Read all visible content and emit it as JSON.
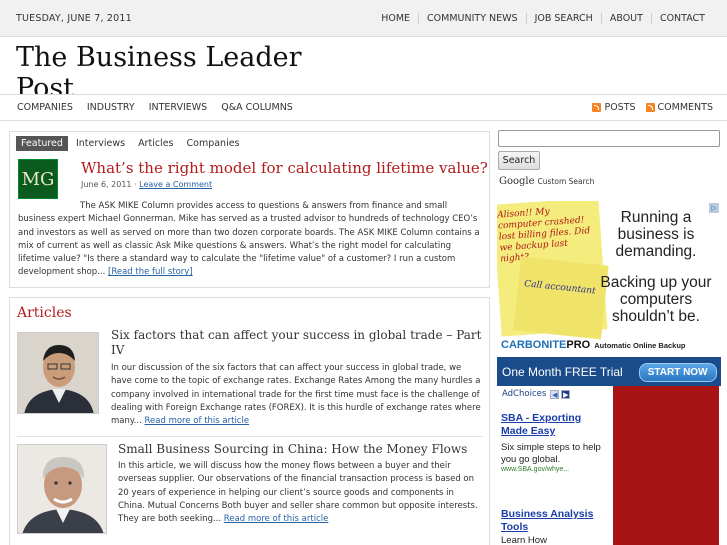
{
  "topbar": {
    "date": "TUESDAY, JUNE 7, 2011",
    "nav": [
      "HOME",
      "COMMUNITY NEWS",
      "JOB SEARCH",
      "ABOUT",
      "CONTACT"
    ]
  },
  "site": {
    "title": "The Business Leader Post"
  },
  "catnav": {
    "items": [
      "COMPANIES",
      "INDUSTRY",
      "INTERVIEWS",
      "Q&A COLUMNS"
    ],
    "posts": "POSTS",
    "comments": "COMMENTS"
  },
  "featured": {
    "tabs": [
      "Featured",
      "Interviews",
      "Articles",
      "Companies"
    ],
    "logo_text": "MG",
    "title": "What’s the right model for calculating lifetime value?",
    "date": "June 6, 2011 ·",
    "comment_link": "Leave a Comment",
    "body": "The ASK MIKE Column provides access to questions & answers from finance and small business expert Michael Gonnerman.  Mike has served as a trusted advisor to hundreds of technology CEO’s and investors as well as served on more than two dozen corporate boards. The ASK MIKE Column contains a mix of current as well as classic Ask Mike questions & answers.  What’s the right model for calculating lifetime value? \"Is there a standard way to calculate the \"lifetime value\" of a customer? I run a custom development shop...",
    "more": "[Read the full story]"
  },
  "articles": {
    "heading": "Articles",
    "items": [
      {
        "title": "Six factors that can affect your success in global trade – Part IV",
        "body": "In our discussion of the six factors that can affect your success in global trade, we have come to the topic of exchange rates. Exchange Rates Among the many hurdles a company involved in international trade for the first time must face is the challenge of dealing with Foreign Exchange rates (FOREX).  It is this hurdle of exchange rates where many...",
        "more": "Read more of this article"
      },
      {
        "title": "Small Business Sourcing in China: How the Money Flows",
        "body": "In this article, we will discuss how the money flows between a buyer and their overseas supplier.  Our observations of the financial transaction process is based on 20 years of experience in helping our client’s source goods and components in China. Mutual Concerns Both buyer and seller share common but opposite interests.  They are both seeking...",
        "more": "Read more of this article"
      }
    ]
  },
  "sidebar": {
    "search_button": "Search",
    "cse_brand": "Google",
    "cse_label": "Custom Search"
  },
  "ad": {
    "sticky_text": "Alison!! My computer crashed! lost billing files. Did we backup last night?",
    "sticky2_text": "Call accountant",
    "headline": "Running a business is demanding.",
    "headline2": "Backing up your computers shouldn’t be.",
    "brand": "CARBONITE",
    "brand_pro": "PRO",
    "tagline": "Automatic Online Backup",
    "offer": "One Month FREE Trial",
    "cta": "START NOW",
    "info_icon": "▷"
  },
  "adchoices": {
    "label": "AdChoices",
    "prev": "◀",
    "next": "▶",
    "links": [
      {
        "title": "SBA - Exporting Made Easy",
        "desc": "Six simple steps to help you go global.",
        "url": "www.SBA.gov/whye..."
      },
      {
        "title": "Business Analysis Tools",
        "desc": "Learn How",
        "url": ""
      }
    ]
  },
  "colors": {
    "accent": "#b31b1b",
    "link": "#2561a5",
    "carbonite_blue": "#1a4c8b"
  }
}
